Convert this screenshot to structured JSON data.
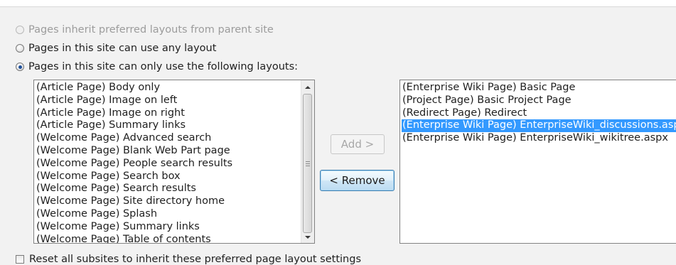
{
  "layout_options": [
    {
      "label": "Pages inherit preferred layouts from parent site",
      "checked": false,
      "enabled": false
    },
    {
      "label": "Pages in this site can use any layout",
      "checked": false,
      "enabled": true
    },
    {
      "label": "Pages in this site can only use the following layouts:",
      "checked": true,
      "enabled": true
    }
  ],
  "available_layouts": [
    "(Article Page) Body only",
    "(Article Page) Image on left",
    "(Article Page) Image on right",
    "(Article Page) Summary links",
    "(Welcome Page) Advanced search",
    "(Welcome Page) Blank Web Part page",
    "(Welcome Page) People search results",
    "(Welcome Page) Search box",
    "(Welcome Page) Search results",
    "(Welcome Page) Site directory home",
    "(Welcome Page) Splash",
    "(Welcome Page) Summary links",
    "(Welcome Page) Table of contents"
  ],
  "selected_layouts": [
    "(Enterprise Wiki Page) Basic Page",
    "(Project Page) Basic Project Page",
    "(Redirect Page) Redirect",
    "(Enterprise Wiki Page) EnterpriseWiki_discussions.aspx",
    "(Enterprise Wiki Page) EnterpriseWiki_wikitree.aspx"
  ],
  "selected_highlight_index": 3,
  "buttons": {
    "add": "Add >",
    "remove": "< Remove"
  },
  "reset_checkbox": {
    "label": "Reset all subsites to inherit these preferred page layout settings",
    "checked": false
  },
  "colors": {
    "selection": "#3399ff",
    "disabled_text": "#9c9c9c"
  }
}
